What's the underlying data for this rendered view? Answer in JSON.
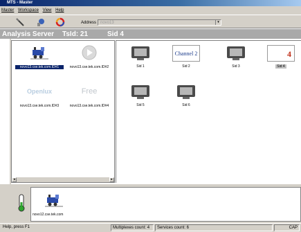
{
  "window": {
    "title": "MTS - Master"
  },
  "menu": [
    "Master",
    "Workspace",
    "View",
    "Help"
  ],
  "toolbar": {
    "address_label": "Address",
    "address_value": "novo13"
  },
  "header": {
    "server": "Analysis Server",
    "tsid": "TsId: 21",
    "sid": "Sid 4"
  },
  "servers": [
    {
      "label": "novo13.cse.tek.com.ID#1",
      "icon": "train-icon",
      "selected": true
    },
    {
      "label": "novo13.cse.tek.com.ID#2",
      "icon": "play-icon",
      "selected": false
    },
    {
      "label": "novo13.cse.tek.com.ID#3",
      "icon": "openlux-logo",
      "logo_text": "Openlux",
      "selected": false
    },
    {
      "label": "novo13.cse.tek.com.ID#4",
      "icon": "free-logo",
      "logo_text": "Free",
      "selected": false
    }
  ],
  "services": [
    {
      "label": "Sid 1",
      "icon": "monitor-icon"
    },
    {
      "label": "Sid 2",
      "icon": "channel-thumbnail",
      "thumb_text": "Channel 2"
    },
    {
      "label": "Sid 3",
      "icon": "monitor-icon"
    },
    {
      "label": "Sid 4",
      "icon": "number-thumbnail",
      "thumb_text": "4",
      "selected": true
    },
    {
      "label": "Sid 5",
      "icon": "monitor-icon"
    },
    {
      "label": "Sid 6",
      "icon": "monitor-icon"
    }
  ],
  "bottom": {
    "label": "novo12.cse.tek.com"
  },
  "status": {
    "help": "Help, press F1",
    "multiplexes": "Multiplexes count: 4",
    "services": "Services count: 6",
    "cap": "CAP"
  }
}
